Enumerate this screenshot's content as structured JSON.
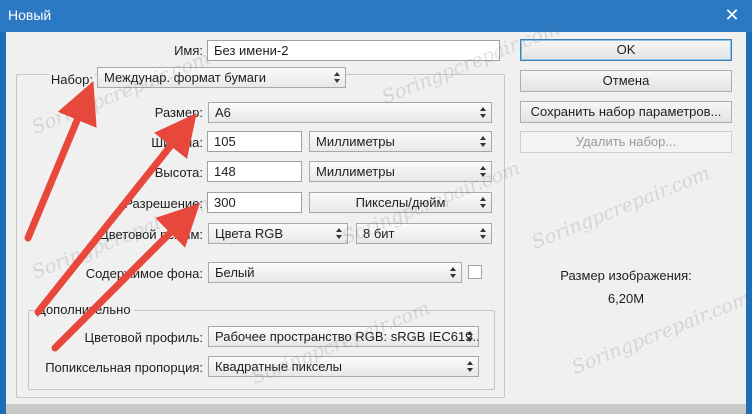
{
  "window": {
    "title": "Новый",
    "close_glyph": "✕"
  },
  "name": {
    "label": "Имя:",
    "value": "Без имени-2"
  },
  "preset": {
    "label": "Набор:",
    "value": "Междунар. формат бумаги"
  },
  "size": {
    "label": "Размер:",
    "value": "A6"
  },
  "width": {
    "label": "Ширина:",
    "value": "105",
    "unit": "Миллиметры"
  },
  "height": {
    "label": "Высота:",
    "value": "148",
    "unit": "Миллиметры"
  },
  "resolution": {
    "label": "Разрешение:",
    "value": "300",
    "unit": "Пикселы/дюйм"
  },
  "color_mode": {
    "label": "Цветовой режим:",
    "value": "Цвета RGB",
    "bits": "8 бит"
  },
  "background": {
    "label": "Содержимое фона:",
    "value": "Белый"
  },
  "advanced": {
    "title": "Дополнительно",
    "color_profile": {
      "label": "Цветовой профиль:",
      "value": "Рабочее пространство RGB:  sRGB IEC619..."
    },
    "pixel_aspect": {
      "label": "Попиксельная пропорция:",
      "value": "Квадратные пикселы"
    }
  },
  "buttons": {
    "ok": "OK",
    "cancel": "Отмена",
    "save_preset": "Сохранить набор параметров...",
    "delete_preset": "Удалить набор..."
  },
  "image_size": {
    "label": "Размер изображения:",
    "value": "6,20M"
  },
  "watermark": "Soringpcrepair.com",
  "colors": {
    "titlebar": "#2b78c5",
    "dialog_bg": "#f0f0f0",
    "arrow": "#e8473c"
  }
}
